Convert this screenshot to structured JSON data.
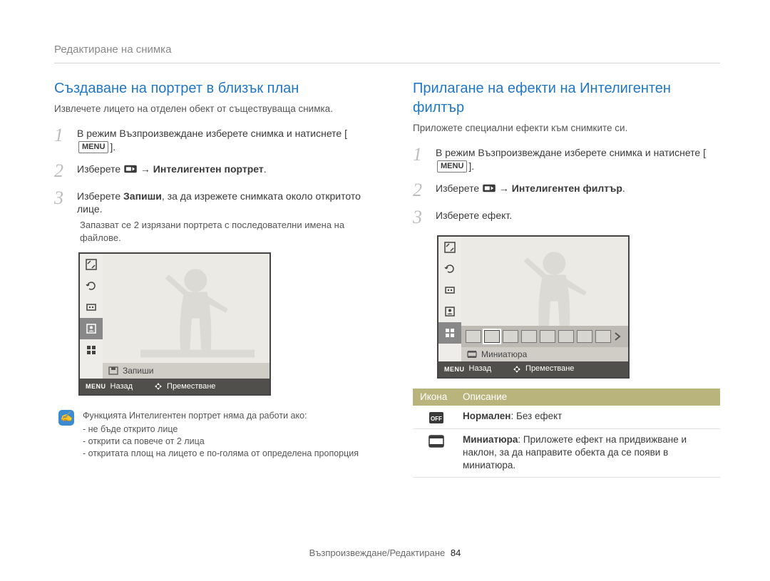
{
  "breadcrumb": "Редактиране на снимка",
  "left": {
    "title": "Създаване на портрет в близък план",
    "lead": "Извлечете лицето на отделен обект от съществуваща снимка.",
    "steps": [
      {
        "num": "1",
        "text_pre": "В режим Възпроизвеждане изберете снимка и натиснете [",
        "btn": "MENU",
        "text_post": "]."
      },
      {
        "num": "2",
        "text_pre": "Изберете ",
        "icon": "edit",
        "text_arrow": " → ",
        "bold": "Интелигентен портрет",
        "text_end": "."
      },
      {
        "num": "3",
        "text_pre": "Изберете ",
        "bold": "Запиши",
        "text_post": ", за да изрежете снимката около откритото лице.",
        "sub": "Запазват се 2 изрязани портрета с последователни имена на файлове."
      }
    ],
    "screen": {
      "caption": "Запиши",
      "bar_back": "Назад",
      "bar_move": "Преместване",
      "bar_menu": "MENU"
    },
    "note": {
      "title": "Функцията Интелигентен портрет няма да работи ако:",
      "items": [
        "не бъде открито лице",
        "открити са повече от 2 лица",
        "откритата площ на лицето е по-голяма от определена пропорция"
      ]
    }
  },
  "right": {
    "title": "Прилагане на ефекти на Интелигентен филтър",
    "lead": "Приложете специални ефекти към снимките си.",
    "steps": [
      {
        "num": "1",
        "text_pre": "В режим Възпроизвеждане изберете снимка и натиснете [",
        "btn": "MENU",
        "text_post": "]."
      },
      {
        "num": "2",
        "text_pre": "Изберете ",
        "icon": "edit",
        "text_arrow": " → ",
        "bold": "Интелигентен филтър",
        "text_end": "."
      },
      {
        "num": "3",
        "text": "Изберете ефект."
      }
    ],
    "screen": {
      "caption": "Миниатюра",
      "bar_back": "Назад",
      "bar_move": "Преместване",
      "bar_menu": "MENU"
    },
    "table": {
      "h1": "Икона",
      "h2": "Описание",
      "rows": [
        {
          "icon": "normal",
          "bold": "Нормален",
          "rest": ": Без ефект"
        },
        {
          "icon": "mini",
          "bold": "Миниатюра",
          "rest": ": Приложете ефект на придвижване и наклон, за да направите обекта да се появи в миниатюра."
        }
      ]
    }
  },
  "footer": {
    "section": "Възпроизвеждане/Редактиране",
    "page": "84"
  }
}
